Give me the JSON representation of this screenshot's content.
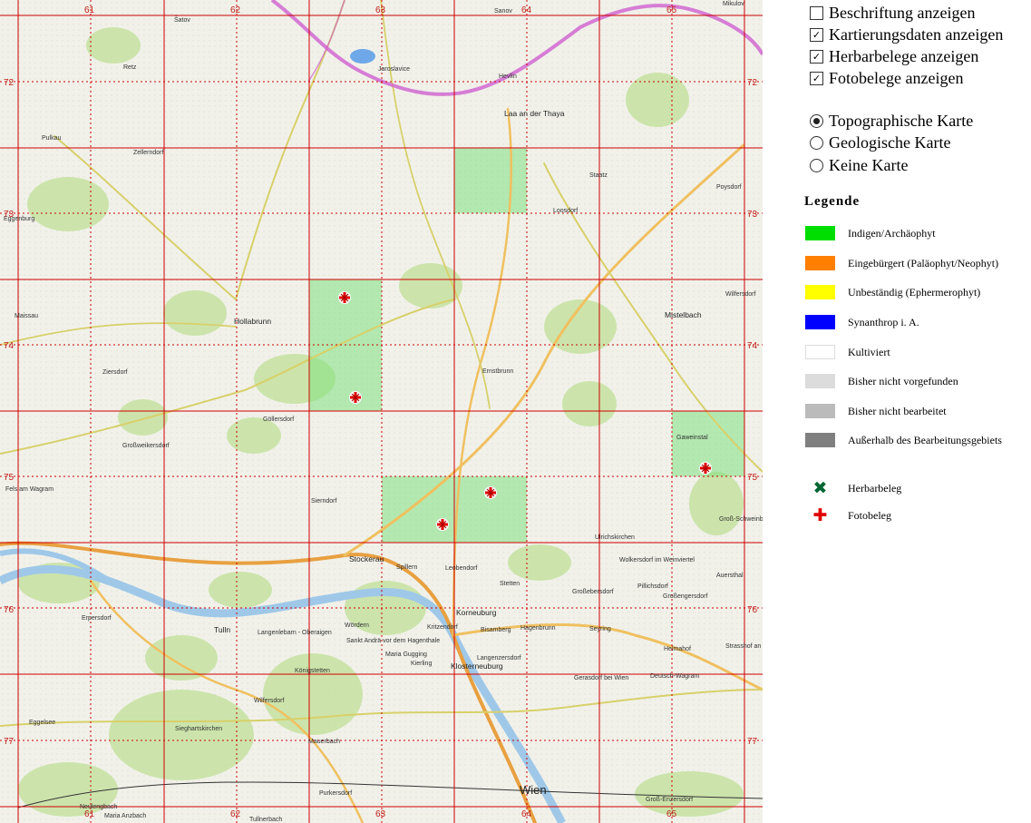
{
  "options": [
    {
      "label": "Beschriftung anzeigen",
      "checked": false
    },
    {
      "label": "Kartierungsdaten anzeigen",
      "checked": true
    },
    {
      "label": "Herbarbelege anzeigen",
      "checked": true
    },
    {
      "label": "Fotobelege anzeigen",
      "checked": true
    }
  ],
  "map_types": [
    {
      "label": "Topographische Karte",
      "selected": true
    },
    {
      "label": "Geologische Karte",
      "selected": false
    },
    {
      "label": "Keine Karte",
      "selected": false
    }
  ],
  "legend": {
    "title": "Legende",
    "items": [
      {
        "label": "Indigen/Archäophyt",
        "color": "#00dd00"
      },
      {
        "label": "Eingebürgert (Paläophyt/Neophyt)",
        "color": "#ff7f00"
      },
      {
        "label": "Unbeständig (Ephermerophyt)",
        "color": "#ffff00"
      },
      {
        "label": "Synanthrop i. A.",
        "color": "#0000ff"
      },
      {
        "label": "Kultiviert",
        "color": "#ffffff"
      },
      {
        "label": "Bisher nicht vorgefunden",
        "color": "#dcdcdc"
      },
      {
        "label": "Bisher nicht bearbeitet",
        "color": "#bbbbbb"
      },
      {
        "label": "Außerhalb des Bearbeitungsgebiets",
        "color": "#7f7f7f"
      }
    ],
    "symbols": [
      {
        "label": "Herbarbeleg",
        "glyph": "✖",
        "color": "#006633"
      },
      {
        "label": "Fotobeleg",
        "glyph": "✚",
        "color": "#e00000"
      }
    ]
  },
  "map": {
    "col_labels": [
      "61",
      "62",
      "63",
      "64",
      "65"
    ],
    "row_labels": [
      "72",
      "73",
      "74",
      "75",
      "76",
      "77"
    ],
    "places": [
      "Šatov",
      "Sanov",
      "Mikulov",
      "Retz",
      "Jaroslavice",
      "Hevlín",
      "Laa an der Thaya",
      "Pulkau",
      "Zellerndorf",
      "Staatz",
      "Poysdorf",
      "Eggenburg",
      "Loosdorf",
      "Maissau",
      "Hollabrunn",
      "Mistelbach",
      "Wilfersdorf",
      "Ziersdorf",
      "Ernstbrunn",
      "Göllersdorf",
      "Großweikersdorf",
      "Gaweinstal",
      "Fels am Wagram",
      "Sierndorf",
      "Ulrichskirchen",
      "Groß-Schweinbarth",
      "Stockerau",
      "Spillern",
      "Leobendorf",
      "Stetten",
      "Wolkersdorf im Weinviertel",
      "Pillichsdorf",
      "Großebersdorf",
      "Großengersdorf",
      "Auersthal",
      "Korneuburg",
      "Bisamberg",
      "Hagenbrunn",
      "Seyring",
      "Tulln",
      "Langenlebarn - Oberaigen",
      "Wördern",
      "Sankt Andrä vor dem Hagenthale",
      "Kritzendorf",
      "Maria Gugging",
      "Kierling",
      "Langenzersdorf",
      "Klosterneuburg",
      "Gerasdorf bei Wien",
      "Deutsch-Wagram",
      "Strasshof an der Nordbahn",
      "Helmahof",
      "Erpersdorf",
      "Königstetten",
      "Wilfersdorf",
      "Siegharts­kirchen",
      "Eggelsee",
      "Mauerbach",
      "Purkersdorf",
      "Wien",
      "Groß-Enzersdorf",
      "Neulengbach",
      "Maria Anzbach",
      "Tullnerbach"
    ],
    "occupied_cells": [
      "64/72.5",
      "62.5/73.5",
      "62.5/74",
      "63/75",
      "63.5/75",
      "65.5/74.5"
    ]
  }
}
